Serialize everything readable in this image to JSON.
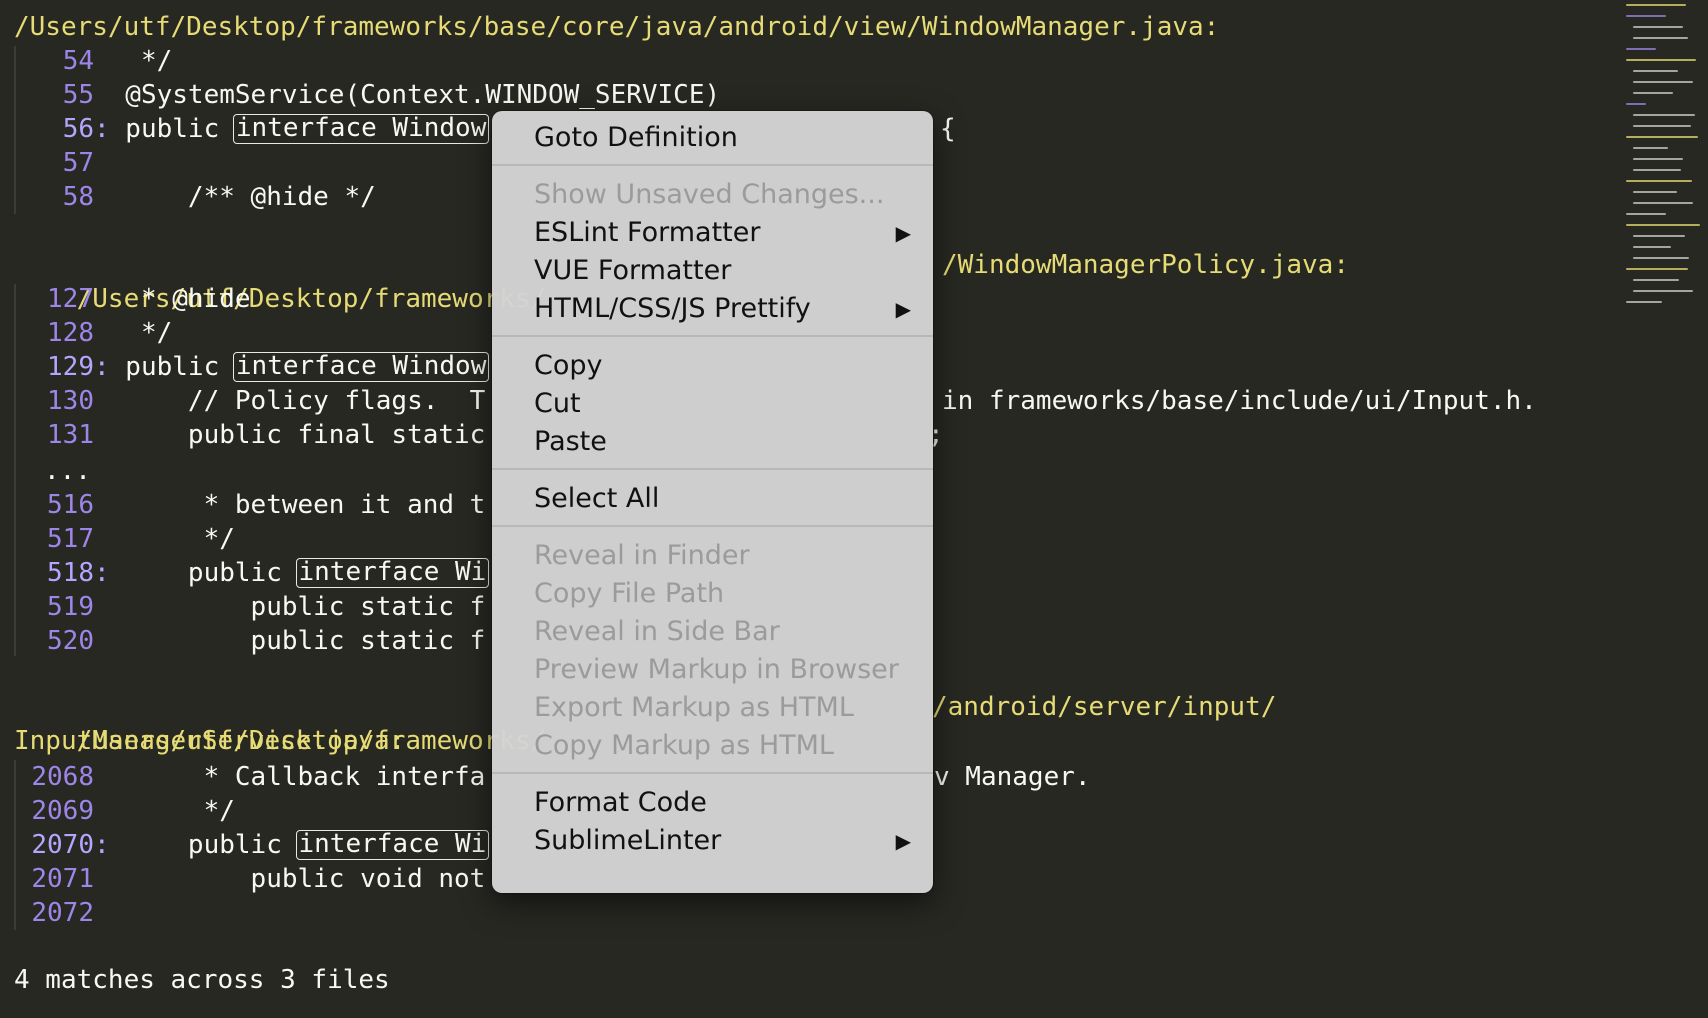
{
  "results": {
    "file1_path": "/Users/utf/Desktop/frameworks/base/core/java/android/view/WindowManager.java:",
    "file1_lines": [
      {
        "num": "54",
        "sep": " ",
        "pre": "  */",
        "hl": "",
        "post": ""
      },
      {
        "num": "55",
        "sep": " ",
        "pre": " @SystemService(Context.WINDOW_SERVICE)",
        "hl": "",
        "post": ""
      },
      {
        "num": "56",
        "sep": ":",
        "pre": " public ",
        "hl": "interface Window",
        "post": ""
      },
      {
        "num": "57",
        "sep": " ",
        "pre": "",
        "hl": "",
        "post": ""
      },
      {
        "num": "58",
        "sep": " ",
        "pre": "     /** @hide */",
        "hl": "",
        "post": ""
      }
    ],
    "file1_line56_tail": "{",
    "file2_path_left": "/Users/utf/Desktop/frameworks/",
    "file2_path_right": "/WindowManagerPolicy.java:",
    "file2_lines": [
      {
        "num": "127",
        "sep": " ",
        "pre": "  * @hide",
        "hl": "",
        "post": ""
      },
      {
        "num": "128",
        "sep": " ",
        "pre": "  */",
        "hl": "",
        "post": ""
      },
      {
        "num": "129",
        "sep": ":",
        "pre": " public ",
        "hl": "interface Window",
        "post": ""
      },
      {
        "num": "130",
        "sep": " ",
        "pre": "     // Policy flags.  T",
        "hl": "",
        "post": ""
      },
      {
        "num": "131",
        "sep": " ",
        "pre": "     public final static",
        "hl": "",
        "post": ""
      }
    ],
    "file2_line130_tail": "in frameworks/base/include/ui/Input.h.",
    "file2_line131_tail": ";",
    "ellipsis": "...",
    "file2_lines_b": [
      {
        "num": "516",
        "sep": " ",
        "pre": "      * between it and t",
        "hl": "",
        "post": ""
      },
      {
        "num": "517",
        "sep": " ",
        "pre": "      */",
        "hl": "",
        "post": ""
      },
      {
        "num": "518",
        "sep": ":",
        "pre": "     public ",
        "hl": "interface Wi",
        "post": ""
      },
      {
        "num": "519",
        "sep": " ",
        "pre": "         public static f",
        "hl": "",
        "post": ""
      },
      {
        "num": "520",
        "sep": " ",
        "pre": "         public static f",
        "hl": "",
        "post": ""
      }
    ],
    "file3_path_left": "/Users/utf/Desktop/frameworks/",
    "file3_path_right": "/android/server/input/",
    "file3_path_line2": "InputManagerService.java:",
    "file3_lines": [
      {
        "num": "2068",
        "sep": " ",
        "pre": "      * Callback interfa",
        "hl": "",
        "post": ""
      },
      {
        "num": "2069",
        "sep": " ",
        "pre": "      */",
        "hl": "",
        "post": ""
      },
      {
        "num": "2070",
        "sep": ":",
        "pre": "     public ",
        "hl": "interface Wi",
        "post": ""
      },
      {
        "num": "2071",
        "sep": " ",
        "pre": "         public void not",
        "hl": "",
        "post": ""
      },
      {
        "num": "2072",
        "sep": " ",
        "pre": "",
        "hl": "",
        "post": ""
      }
    ],
    "file3_line2068_tail": "v Manager.",
    "status": "4 matches across 3 files"
  },
  "context_menu": {
    "items": [
      {
        "label": "Goto Definition",
        "enabled": true,
        "submenu": false
      },
      {
        "label": "Show Unsaved Changes...",
        "enabled": false,
        "submenu": false
      },
      {
        "label": "ESLint Formatter",
        "enabled": true,
        "submenu": true
      },
      {
        "label": "VUE Formatter",
        "enabled": true,
        "submenu": false
      },
      {
        "label": "HTML/CSS/JS Prettify",
        "enabled": true,
        "submenu": true
      },
      {
        "label": "Copy",
        "enabled": true,
        "submenu": false
      },
      {
        "label": "Cut",
        "enabled": true,
        "submenu": false
      },
      {
        "label": "Paste",
        "enabled": true,
        "submenu": false
      },
      {
        "label": "Select All",
        "enabled": true,
        "submenu": false
      },
      {
        "label": "Reveal in Finder",
        "enabled": false,
        "submenu": false
      },
      {
        "label": "Copy File Path",
        "enabled": false,
        "submenu": false
      },
      {
        "label": "Reveal in Side Bar",
        "enabled": false,
        "submenu": false
      },
      {
        "label": "Preview Markup in Browser",
        "enabled": false,
        "submenu": false
      },
      {
        "label": "Export Markup as HTML",
        "enabled": false,
        "submenu": false
      },
      {
        "label": "Copy Markup as HTML",
        "enabled": false,
        "submenu": false
      },
      {
        "label": "Format Code",
        "enabled": true,
        "submenu": false
      },
      {
        "label": "SublimeLinter",
        "enabled": true,
        "submenu": true
      }
    ],
    "submenu_arrow": "▶"
  },
  "colors": {
    "background": "#272822",
    "path": "#e6db74",
    "line_number": "#9d86e8",
    "text": "#f8f8f2",
    "menu_bg": "#d4d4d4",
    "menu_disabled": "#9b9b9b"
  }
}
